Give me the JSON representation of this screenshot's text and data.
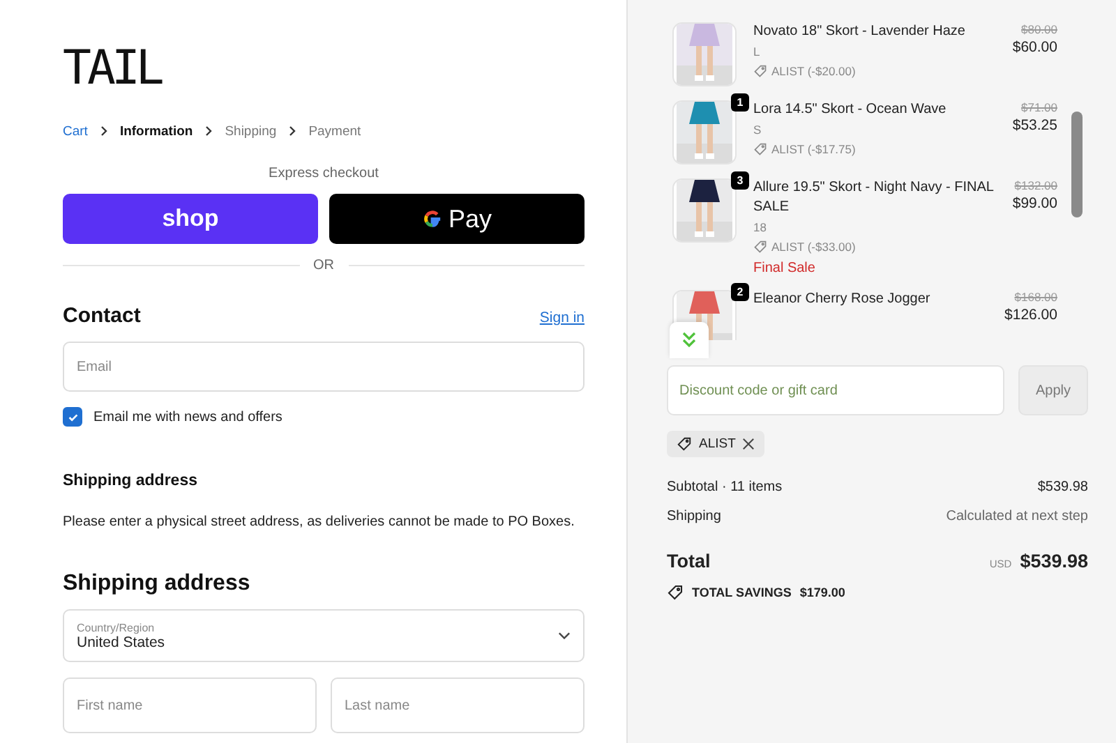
{
  "logo": "TAIL",
  "breadcrumbs": [
    {
      "label": "Cart",
      "kind": "link"
    },
    {
      "label": "Information",
      "kind": "current"
    },
    {
      "label": "Shipping",
      "kind": "pending"
    },
    {
      "label": "Payment",
      "kind": "pending"
    }
  ],
  "express_checkout": {
    "title": "Express checkout",
    "buttons": [
      {
        "kind": "shop",
        "label": "shop"
      },
      {
        "kind": "gpay",
        "label": "Pay"
      }
    ],
    "divider": "OR"
  },
  "contact": {
    "heading": "Contact",
    "sign_in": "Sign in",
    "email": {
      "placeholder": "Email"
    },
    "newsletter": {
      "label": "Email me with news and offers",
      "checked": true
    }
  },
  "shipping_notice": {
    "heading": "Shipping address",
    "text": "Please enter a physical street address, as deliveries cannot be made to PO Boxes."
  },
  "shipping_address": {
    "heading": "Shipping address",
    "country": {
      "label": "Country/Region",
      "value": "United States"
    },
    "first_name": {
      "placeholder": "First name"
    },
    "last_name": {
      "placeholder": "Last name"
    }
  },
  "cart": {
    "items": [
      {
        "kind": "picture",
        "name": "Novato 18\" Skort - Lavender Haze",
        "variant": "L",
        "discount": "ALIST (-$20.00)",
        "original_price": "$80.00",
        "price": "$60.00"
      },
      {
        "kind": "picture",
        "quantity": "1",
        "name": "Lora 14.5\" Skort - Ocean Wave",
        "variant": "S",
        "discount": "ALIST (-$17.75)",
        "original_price": "$71.00",
        "price": "$53.25"
      },
      {
        "kind": "picture",
        "quantity": "3",
        "name": "Allure 19.5\" Skort - Night Navy - FINAL SALE",
        "variant": "18",
        "discount": "ALIST (-$33.00)",
        "note": "Final Sale",
        "original_price": "$132.00",
        "price": "$99.00"
      },
      {
        "kind": "picture",
        "quantity": "2",
        "name": "Eleanor Cherry Rose Jogger",
        "original_price": "$168.00",
        "price": "$126.00"
      }
    ]
  },
  "discount": {
    "placeholder": "Discount code or gift card",
    "apply": {
      "label": "Apply",
      "disabled": true
    },
    "applied_codes": [
      {
        "code": "ALIST"
      }
    ]
  },
  "summary": {
    "subtotal": {
      "label": "Subtotal · 11 items",
      "value": "$539.98"
    },
    "shipping": {
      "label": "Shipping",
      "value": "Calculated at next step"
    },
    "total": {
      "label": "Total",
      "currency": "USD",
      "value": "$539.98"
    },
    "savings": {
      "label": "TOTAL SAVINGS",
      "value": "$179.00"
    }
  }
}
